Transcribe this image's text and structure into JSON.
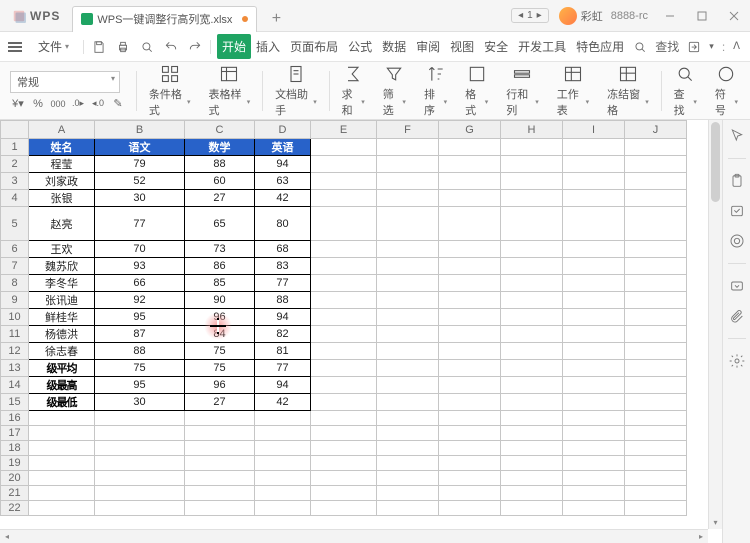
{
  "app": {
    "logo": "WPS",
    "filename": "WPS一键调整行高列宽.xlsx",
    "pager": "1",
    "username": "彩虹",
    "account": "8888-rc"
  },
  "menu": {
    "file": "文件",
    "tabs": [
      "开始",
      "插入",
      "页面布局",
      "公式",
      "数据",
      "审阅",
      "视图",
      "安全",
      "开发工具",
      "特色应用"
    ],
    "search": "查找"
  },
  "ribbon": {
    "format_sel": "常规",
    "items": [
      "条件格式",
      "表格样式",
      "文档助手",
      "求和",
      "筛选",
      "排序",
      "格式",
      "行和列",
      "工作表",
      "冻结窗格",
      "查找",
      "符号"
    ]
  },
  "sheet": {
    "cols": [
      "A",
      "B",
      "C",
      "D",
      "E",
      "F",
      "G",
      "H",
      "I",
      "J"
    ],
    "header": [
      "姓名",
      "语文",
      "数学",
      "英语"
    ],
    "rows": [
      {
        "n": "程莹",
        "v": [
          "79",
          "88",
          "94"
        ]
      },
      {
        "n": "刘家政",
        "v": [
          "52",
          "60",
          "63"
        ]
      },
      {
        "n": "张银",
        "v": [
          "30",
          "27",
          "42"
        ]
      },
      {
        "n": "赵亮",
        "v": [
          "77",
          "65",
          "80"
        ],
        "tall": true
      },
      {
        "n": "王欢",
        "v": [
          "70",
          "73",
          "68"
        ]
      },
      {
        "n": "魏苏欣",
        "v": [
          "93",
          "86",
          "83"
        ]
      },
      {
        "n": "李冬华",
        "v": [
          "66",
          "85",
          "77"
        ]
      },
      {
        "n": "张讯迪",
        "v": [
          "92",
          "90",
          "88"
        ]
      },
      {
        "n": "鲜桂华",
        "v": [
          "95",
          "96",
          "94"
        ]
      },
      {
        "n": "杨德洪",
        "v": [
          "87",
          "84",
          "82"
        ]
      },
      {
        "n": "徐志春",
        "v": [
          "88",
          "75",
          "81"
        ]
      },
      {
        "n": "级平均",
        "v": [
          "75",
          "75",
          "77"
        ],
        "w": true
      },
      {
        "n": "级最高",
        "v": [
          "95",
          "96",
          "94"
        ],
        "w": true
      },
      {
        "n": "级最低",
        "v": [
          "30",
          "27",
          "42"
        ],
        "w": true
      }
    ],
    "empty_rows": 7
  }
}
